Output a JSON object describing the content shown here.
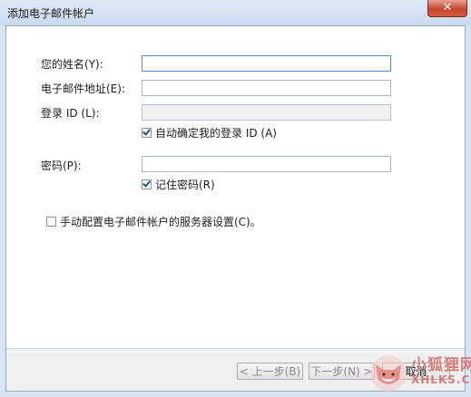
{
  "window": {
    "title": "添加电子邮件帐户",
    "close_glyph": "✕"
  },
  "form": {
    "name_label": "您的姓名(Y):",
    "name_value": "",
    "email_label": "电子邮件地址(E):",
    "email_value": "",
    "login_label": "登录 ID (L):",
    "login_value": "",
    "auto_login_label": "自动确定我的登录 ID (A)",
    "auto_login_checked": true,
    "password_label": "密码(P):",
    "password_value": "",
    "remember_label": "记住密码(R)",
    "remember_checked": true,
    "manual_label": "手动配置电子邮件帐户的服务器设置(C)。",
    "manual_checked": false
  },
  "footer": {
    "back_label": "< 上一步(B)",
    "next_label": "下一步(N) >",
    "cancel_label": "取消"
  },
  "watermark": {
    "text": "小狐狸网",
    "sub": "XHLKS.CN"
  }
}
